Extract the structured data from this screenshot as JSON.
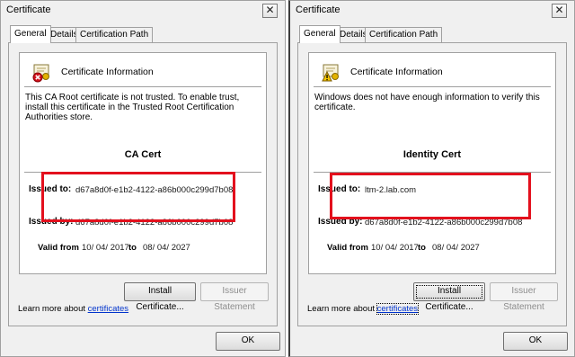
{
  "left": {
    "window_title": "Certificate",
    "close_glyph": "✕",
    "tabs": [
      "General",
      "Details",
      "Certification Path"
    ],
    "info_title": "Certificate Information",
    "icon": "cert-error-icon",
    "description": "This CA Root certificate is not trusted. To enable trust, install this certificate in the Trusted Root Certification Authorities store.",
    "cert_name": "CA Cert",
    "issued_to_label": "Issued to:",
    "issued_to": "d67a8d0f-e1b2-4122-a86b000c299d7b08",
    "issued_by_label": "Issued by:",
    "issued_by": "d67a8d0f-e1b2-4122-a86b000c299d7b08",
    "valid_from_label": "Valid from",
    "valid_from": "10/ 04/ 2017",
    "to_label": "to",
    "valid_to": "08/ 04/ 2027",
    "install_button": "Install Certificate...",
    "issuer_statement_button": "Issuer Statement",
    "learn_prefix": "Learn more about",
    "learn_link": "certificates",
    "ok_button": "OK"
  },
  "right": {
    "window_title": "Certificate",
    "close_glyph": "✕",
    "tabs": [
      "General",
      "Details",
      "Certification Path"
    ],
    "info_title": "Certificate Information",
    "icon": "cert-warning-icon",
    "description": "Windows does not have enough information to verify this certificate.",
    "cert_name": "Identity Cert",
    "issued_to_label": "Issued to:",
    "issued_to": "ltm-2.lab.com",
    "issued_by_label": "Issued by:",
    "issued_by": "d67a8d0f-e1b2-4122-a86b000c299d7b08",
    "valid_from_label": "Valid from",
    "valid_from": "10/ 04/ 2017",
    "to_label": "to",
    "valid_to": "08/ 04/ 2027",
    "install_button": "Install Certificate...",
    "issuer_statement_button": "Issuer Statement",
    "learn_prefix": "Learn more about",
    "learn_link": "certificates",
    "ok_button": "OK"
  },
  "colors": {
    "highlight": "#e3101d",
    "link": "#0033cc"
  }
}
